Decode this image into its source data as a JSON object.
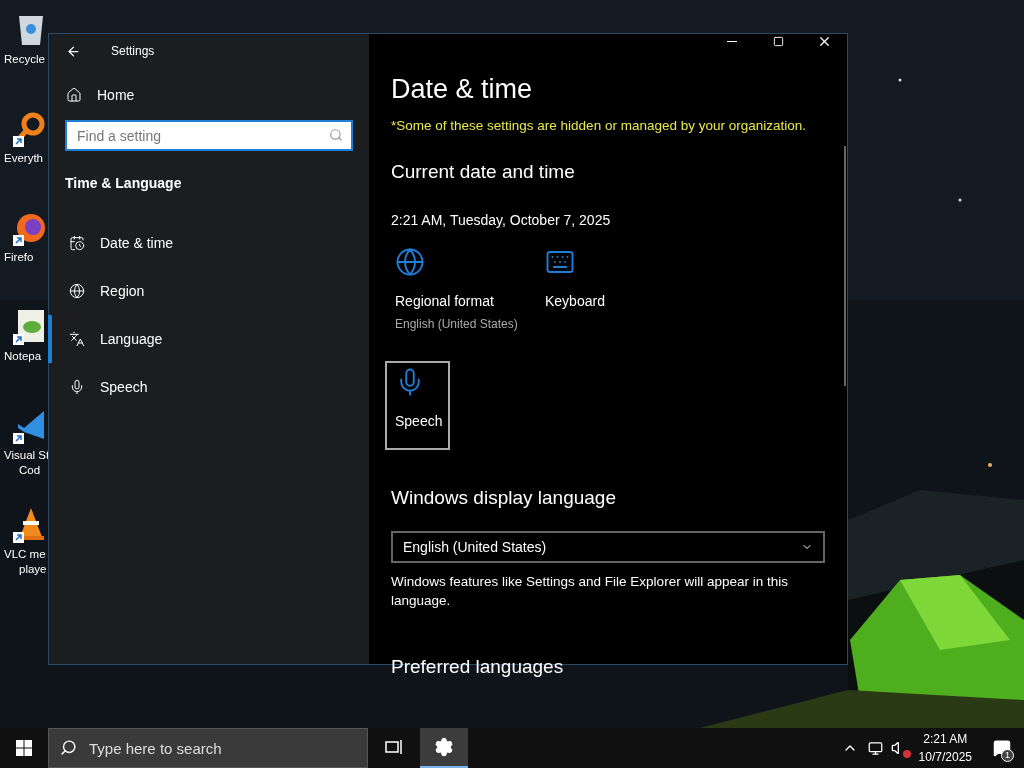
{
  "desktop": {
    "icons": [
      {
        "kind": "recycle",
        "shortcut": false,
        "lines": [
          "Recycle"
        ]
      },
      {
        "kind": "search-app",
        "shortcut": true,
        "lines": [
          "Everyth"
        ]
      },
      {
        "kind": "browser",
        "shortcut": true,
        "lines": [
          "Firefo"
        ]
      },
      {
        "kind": "notepad",
        "shortcut": true,
        "lines": [
          "Notepa"
        ]
      },
      {
        "kind": "code",
        "shortcut": true,
        "lines": [
          "Visual St",
          "Cod"
        ]
      },
      {
        "kind": "cone",
        "shortcut": true,
        "lines": [
          "VLC me",
          "playe"
        ]
      }
    ]
  },
  "window": {
    "title": "Settings",
    "sidebar": {
      "home": "Home",
      "search": {
        "placeholder": "Find a setting"
      },
      "section": "Time & Language",
      "items": [
        {
          "kind": "date",
          "label": "Date & time",
          "selected": false
        },
        {
          "kind": "region",
          "label": "Region",
          "selected": false
        },
        {
          "kind": "language",
          "label": "Language",
          "selected": true
        },
        {
          "kind": "speech",
          "label": "Speech",
          "selected": false
        }
      ]
    },
    "content": {
      "title": "Date & time",
      "notice": "*Some of these settings are hidden or managed by your organization.",
      "current_heading": "Current date and time",
      "current_value": "2:21 AM, Tuesday, October 7, 2025",
      "tiles": [
        {
          "kind": "globe",
          "label": "Regional format",
          "sublabel": "English (United States)",
          "focused": false
        },
        {
          "kind": "keyboard",
          "label": "Keyboard",
          "focused": false
        },
        {
          "kind": "mic",
          "label": "Speech",
          "focused": true
        }
      ],
      "display_heading": "Windows display language",
      "display_value": "English (United States)",
      "display_note": "Windows features like Settings and File Explorer will appear in this language.",
      "preferred_heading": "Preferred languages"
    }
  },
  "taskbar": {
    "search": {
      "placeholder": "Type here to search"
    },
    "apps": [
      {
        "kind": "taskview",
        "selected": false
      },
      {
        "kind": "settings",
        "selected": true
      }
    ],
    "time": "2:21 AM",
    "date": "10/7/2025",
    "notifications": "1"
  }
}
